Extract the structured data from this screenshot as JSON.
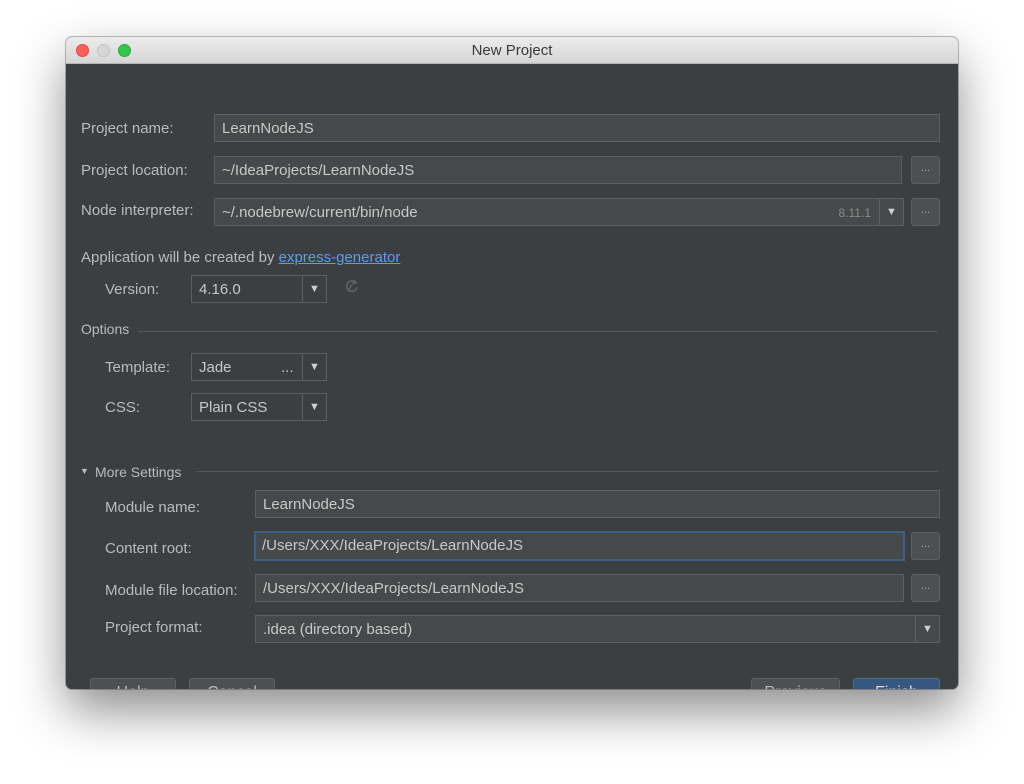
{
  "window": {
    "title": "New Project"
  },
  "project": {
    "name_label": "Project name:",
    "name_value": "LearnNodeJS",
    "location_label": "Project location:",
    "location_value": "~/IdeaProjects/LearnNodeJS",
    "interpreter_label": "Node interpreter:",
    "interpreter_value": "~/.nodebrew/current/bin/node",
    "interpreter_version": "8.11.1"
  },
  "generator": {
    "prefix": "Application will be created by ",
    "link": "express-generator",
    "version_label": "Version:",
    "version_value": "4.16.0"
  },
  "options": {
    "section_label": "Options",
    "template_label": "Template:",
    "template_value": "Jade",
    "template_ellipsis": "...",
    "css_label": "CSS:",
    "css_value": "Plain CSS"
  },
  "more_settings": {
    "section_label": "More Settings",
    "module_name_label": "Module name:",
    "module_name_value": "LearnNodeJS",
    "content_root_label": "Content root:",
    "content_root_value": "/Users/XXX/IdeaProjects/LearnNodeJS",
    "module_file_label": "Module file location:",
    "module_file_value": "/Users/XXX/IdeaProjects/LearnNodeJS",
    "format_label": "Project format:",
    "format_value": ".idea (directory based)"
  },
  "buttons": {
    "browse": "...",
    "help": "Help",
    "cancel": "Cancel",
    "previous": "Previous",
    "finish": "Finish"
  },
  "icons": {
    "dropdown": "chevron-down-icon",
    "refresh": "refresh-icon",
    "collapse": "triangle-down-icon"
  }
}
